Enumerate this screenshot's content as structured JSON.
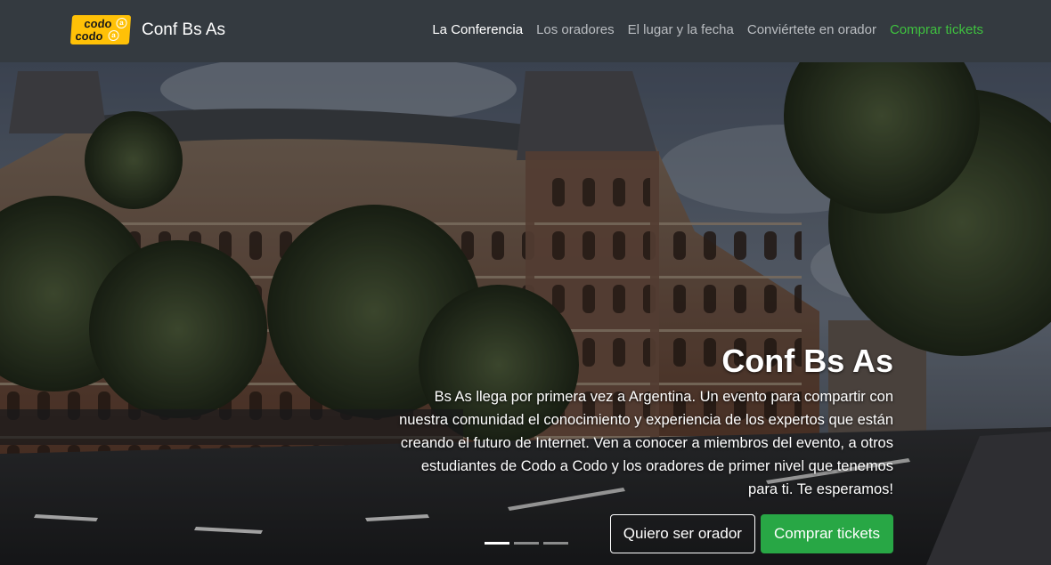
{
  "navbar": {
    "logo_top": "codo",
    "logo_bottom": "codo",
    "logo_dot1": "a",
    "logo_dot2": "a",
    "brand": "Conf Bs As",
    "links": [
      {
        "label": "La Conferencia",
        "state": "active"
      },
      {
        "label": "Los oradores"
      },
      {
        "label": "El lugar y la fecha"
      },
      {
        "label": "Conviértete en orador"
      },
      {
        "label": "Comprar tickets",
        "color": "#3fc13f"
      }
    ]
  },
  "hero": {
    "title": "Conf Bs As",
    "text": "Bs As llega por primera vez a Argentina. Un evento para compartir con nuestra comunidad el conocimiento y experiencia de los expertos que están creando el futuro de Internet. Ven a conocer a miembros del evento, a otros estudiantes de Codo a Codo y los oradores de primer nivel que tenemos para ti. Te esperamos!",
    "btn_speaker": "Quiero ser orador",
    "btn_tickets": "Comprar tickets",
    "slides_count": 3,
    "active_slide": 1
  },
  "colors": {
    "navbar_bg": "#343a40",
    "accent_green": "#28a745",
    "logo_yellow": "#ffc107"
  }
}
